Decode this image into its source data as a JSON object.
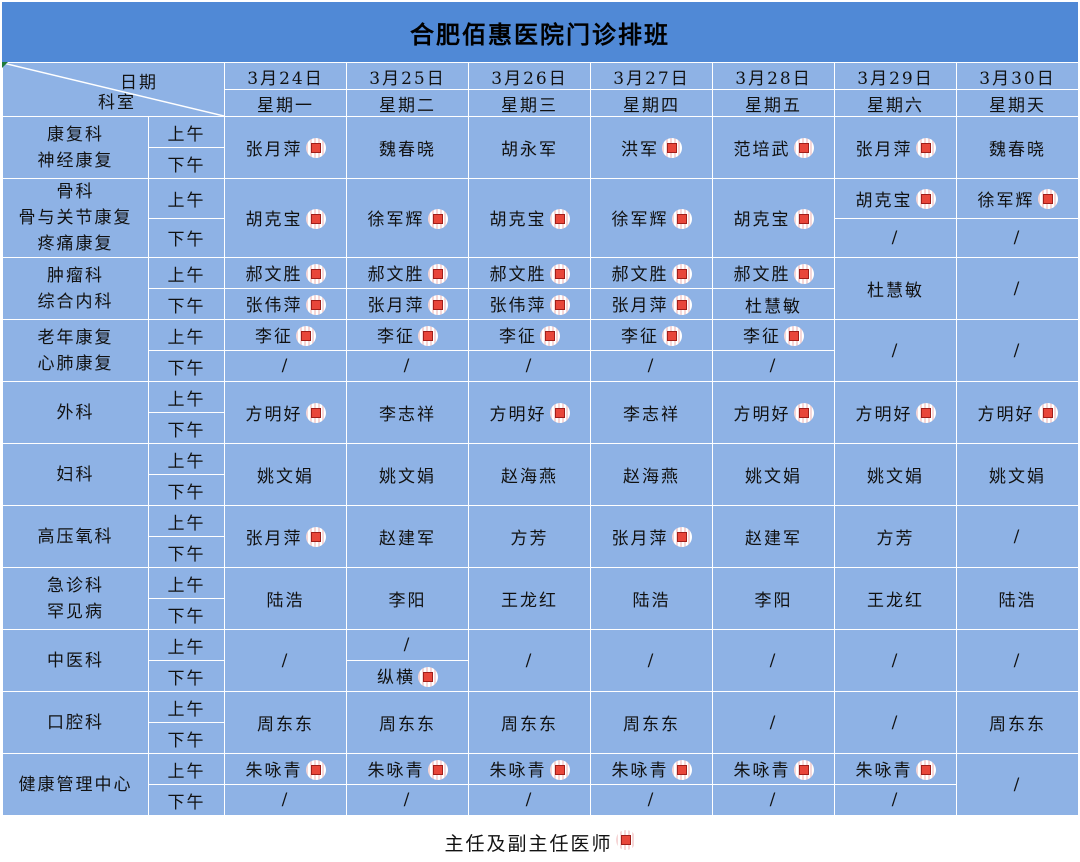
{
  "title": "合肥佰惠医院门诊排班",
  "corner": {
    "date_label": "日期",
    "dept_label": "科室"
  },
  "dates": [
    "3月24日",
    "3月25日",
    "3月26日",
    "3月27日",
    "3月28日",
    "3月29日",
    "3月30日"
  ],
  "weekdays": [
    "星期一",
    "星期二",
    "星期三",
    "星期四",
    "星期五",
    "星期六",
    "星期天"
  ],
  "am": "上午",
  "pm": "下午",
  "legend": {
    "label": "主任及副主任医师",
    "icon": "chief-physician-mark-icon"
  },
  "mark_colors": {
    "fill": "#e8463a",
    "stripe": "#f6d7d7"
  },
  "departments": [
    {
      "lines": [
        "康复科",
        "神经康复"
      ],
      "cells": [
        {
          "name": "张月萍",
          "mark": true
        },
        {
          "name": "魏春晓"
        },
        {
          "name": "胡永军"
        },
        {
          "name": "洪军",
          "mark": true
        },
        {
          "name": "范培武",
          "mark": true
        },
        {
          "name": "张月萍",
          "mark": true
        },
        {
          "name": "魏春晓"
        }
      ]
    },
    {
      "lines": [
        "骨科",
        "骨与关节康复",
        "疼痛康复"
      ],
      "cells": [
        {
          "name": "胡克宝",
          "mark": true
        },
        {
          "name": "徐军辉",
          "mark": true
        },
        {
          "name": "胡克宝",
          "mark": true
        },
        {
          "name": "徐军辉",
          "mark": true
        },
        {
          "name": "胡克宝",
          "mark": true
        },
        {
          "am": {
            "name": "胡克宝",
            "mark": true
          },
          "pm": {
            "name": "/"
          }
        },
        {
          "am": {
            "name": "徐军辉",
            "mark": true
          },
          "pm": {
            "name": "/"
          }
        }
      ]
    },
    {
      "lines": [
        "肿瘤科",
        "综合内科"
      ],
      "cells": [
        {
          "am": {
            "name": "郝文胜",
            "mark": true
          },
          "pm": {
            "name": "张伟萍",
            "mark": true
          }
        },
        {
          "am": {
            "name": "郝文胜",
            "mark": true
          },
          "pm": {
            "name": "张月萍",
            "mark": true
          }
        },
        {
          "am": {
            "name": "郝文胜",
            "mark": true
          },
          "pm": {
            "name": "张伟萍",
            "mark": true
          }
        },
        {
          "am": {
            "name": "郝文胜",
            "mark": true
          },
          "pm": {
            "name": "张月萍",
            "mark": true
          }
        },
        {
          "am": {
            "name": "郝文胜",
            "mark": true
          },
          "pm": {
            "name": "杜慧敏"
          }
        },
        {
          "name": "杜慧敏"
        },
        {
          "name": "/"
        }
      ]
    },
    {
      "lines": [
        "老年康复",
        "心肺康复"
      ],
      "cells": [
        {
          "am": {
            "name": "李征",
            "mark": true
          },
          "pm": {
            "name": "/"
          }
        },
        {
          "am": {
            "name": "李征",
            "mark": true
          },
          "pm": {
            "name": "/"
          }
        },
        {
          "am": {
            "name": "李征",
            "mark": true
          },
          "pm": {
            "name": "/"
          }
        },
        {
          "am": {
            "name": "李征",
            "mark": true
          },
          "pm": {
            "name": "/"
          }
        },
        {
          "am": {
            "name": "李征",
            "mark": true
          },
          "pm": {
            "name": "/"
          }
        },
        {
          "name": "/"
        },
        {
          "name": "/"
        }
      ]
    },
    {
      "lines": [
        "外科"
      ],
      "cells": [
        {
          "name": "方明好",
          "mark": true
        },
        {
          "name": "李志祥"
        },
        {
          "name": "方明好",
          "mark": true
        },
        {
          "name": "李志祥"
        },
        {
          "name": "方明好",
          "mark": true
        },
        {
          "name": "方明好",
          "mark": true
        },
        {
          "name": "方明好",
          "mark": true
        }
      ]
    },
    {
      "lines": [
        "妇科"
      ],
      "cells": [
        {
          "name": "姚文娟"
        },
        {
          "name": "姚文娟"
        },
        {
          "name": "赵海燕"
        },
        {
          "name": "赵海燕"
        },
        {
          "name": "姚文娟"
        },
        {
          "name": "姚文娟"
        },
        {
          "name": "姚文娟"
        }
      ]
    },
    {
      "lines": [
        "高压氧科"
      ],
      "cells": [
        {
          "name": "张月萍",
          "mark": true
        },
        {
          "name": "赵建军"
        },
        {
          "name": "方芳"
        },
        {
          "name": "张月萍",
          "mark": true
        },
        {
          "name": "赵建军"
        },
        {
          "name": "方芳"
        },
        {
          "name": "/"
        }
      ]
    },
    {
      "lines": [
        "急诊科",
        "罕见病"
      ],
      "cells": [
        {
          "name": "陆浩"
        },
        {
          "name": "李阳"
        },
        {
          "name": "王龙红"
        },
        {
          "name": "陆浩"
        },
        {
          "name": "李阳"
        },
        {
          "name": "王龙红"
        },
        {
          "name": "陆浩"
        }
      ]
    },
    {
      "lines": [
        "中医科"
      ],
      "cells": [
        {
          "name": "/"
        },
        {
          "am": {
            "name": "/"
          },
          "pm": {
            "name": "纵横",
            "mark": true
          }
        },
        {
          "name": "/"
        },
        {
          "name": "/"
        },
        {
          "name": "/"
        },
        {
          "name": "/"
        },
        {
          "name": "/"
        }
      ]
    },
    {
      "lines": [
        "口腔科"
      ],
      "cells": [
        {
          "name": "周东东"
        },
        {
          "name": "周东东"
        },
        {
          "name": "周东东"
        },
        {
          "name": "周东东"
        },
        {
          "name": "/"
        },
        {
          "name": "/"
        },
        {
          "name": "周东东"
        }
      ]
    },
    {
      "lines": [
        "健康管理中心"
      ],
      "cells": [
        {
          "am": {
            "name": "朱咏青",
            "mark": true
          },
          "pm": {
            "name": "/"
          }
        },
        {
          "am": {
            "name": "朱咏青",
            "mark": true
          },
          "pm": {
            "name": "/"
          }
        },
        {
          "am": {
            "name": "朱咏青",
            "mark": true
          },
          "pm": {
            "name": "/"
          }
        },
        {
          "am": {
            "name": "朱咏青",
            "mark": true
          },
          "pm": {
            "name": "/"
          }
        },
        {
          "am": {
            "name": "朱咏青",
            "mark": true
          },
          "pm": {
            "name": "/"
          }
        },
        {
          "am": {
            "name": "朱咏青",
            "mark": true
          },
          "pm": {
            "name": "/"
          }
        },
        {
          "name": "/"
        }
      ]
    }
  ]
}
